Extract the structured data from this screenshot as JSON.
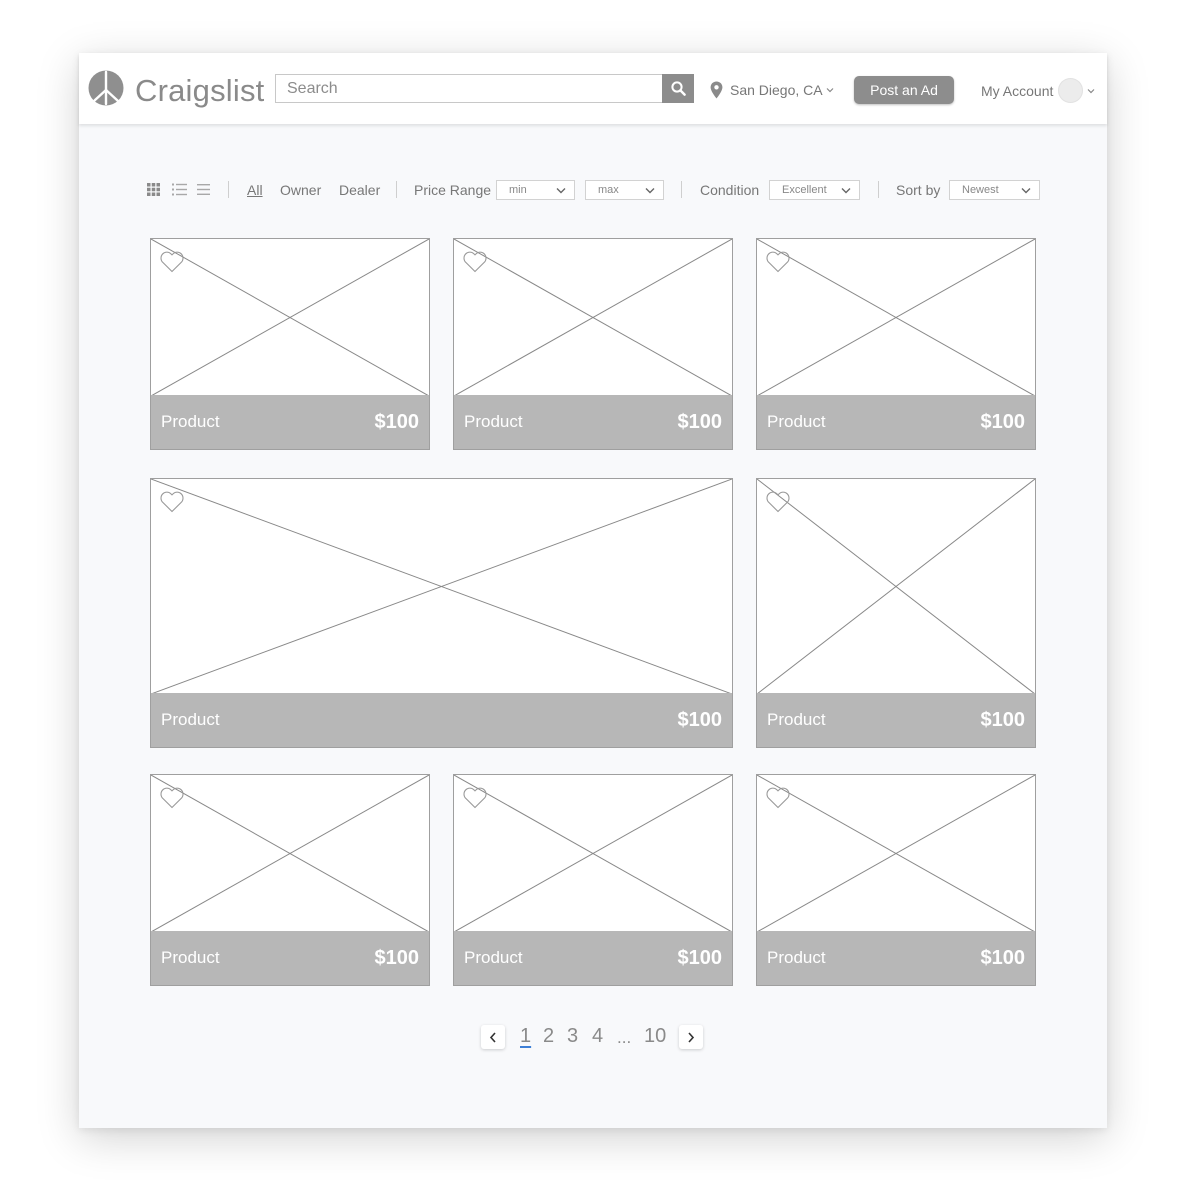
{
  "header": {
    "brand": "Craigslist",
    "search_placeholder": "Search",
    "location": "San Diego, CA",
    "post_ad_label": "Post an Ad",
    "account_label": "My Account"
  },
  "filters": {
    "seller": [
      "All",
      "Owner",
      "Dealer"
    ],
    "price_range_label": "Price Range",
    "price_min": "min",
    "price_max": "max",
    "condition_label": "Condition",
    "condition_value": "Excellent",
    "sort_label": "Sort by",
    "sort_value": "Newest"
  },
  "products": [
    {
      "name": "Product",
      "price": "$100"
    },
    {
      "name": "Product",
      "price": "$100"
    },
    {
      "name": "Product",
      "price": "$100"
    },
    {
      "name": "Product",
      "price": "$100"
    },
    {
      "name": "Product",
      "price": "$100"
    },
    {
      "name": "Product",
      "price": "$100"
    },
    {
      "name": "Product",
      "price": "$100"
    },
    {
      "name": "Product",
      "price": "$100"
    }
  ],
  "pagination": {
    "pages": [
      "1",
      "2",
      "3",
      "4",
      "...",
      "10"
    ],
    "current": "1"
  },
  "colors": {
    "footer_bg": "#b7b7b7",
    "post_button": "#8d8d8d",
    "current_page_underline": "#3d7fd6"
  }
}
